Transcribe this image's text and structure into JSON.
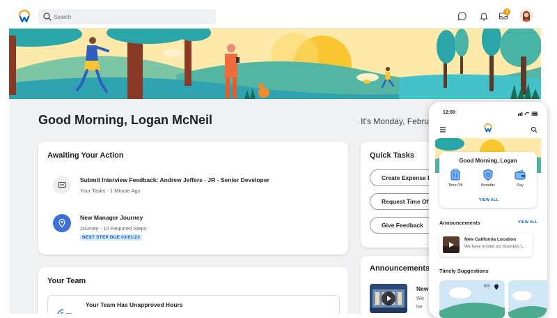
{
  "topbar": {
    "search_placeholder": "Search",
    "notification_count": "3"
  },
  "greeting": "Good Morning, Logan McNeil",
  "date_text": "It's Monday, February",
  "awaiting": {
    "title": "Awaiting Your Action",
    "items": [
      {
        "title": "Submit Interview Feedback: Andrew Jeffers - JR - Senior Developer",
        "subtitle": "Your Tasks - 1 Minute Ago"
      },
      {
        "title": "New Manager Journey",
        "subtitle": "Journey - 10 Required Steps",
        "tag": "NEXT STEP DUE 03/01/23"
      }
    ]
  },
  "quick_tasks": {
    "title": "Quick Tasks",
    "buttons": [
      "Create Expense Re",
      "Request Time Off",
      "Give Feedback"
    ]
  },
  "your_team": {
    "title": "Your Team",
    "item_title": "Your Team Has Unapproved Hours"
  },
  "announcements": {
    "title": "Announcements",
    "item_title": "New",
    "item_lines": [
      "We",
      "he",
      "e"
    ]
  },
  "phone": {
    "time": "12:00",
    "greeting": "Good Morning, Logan",
    "apps": [
      "Time Off",
      "Benefits",
      "Pay"
    ],
    "view_all": "VIEW ALL",
    "announcements_title": "Announcements",
    "announcements_view_all": "VIEW ALL",
    "announcement": {
      "title": "New California Location",
      "text": "We have moved our business t..."
    },
    "timely_title": "Timely Suggestions",
    "suggestion_count": "0/3"
  },
  "colors": {
    "accent": "#0a63c9",
    "brand_orange": "#f6a21e",
    "hero_sky": "#fde7a3",
    "hero_teal": "#2aa6a9"
  }
}
